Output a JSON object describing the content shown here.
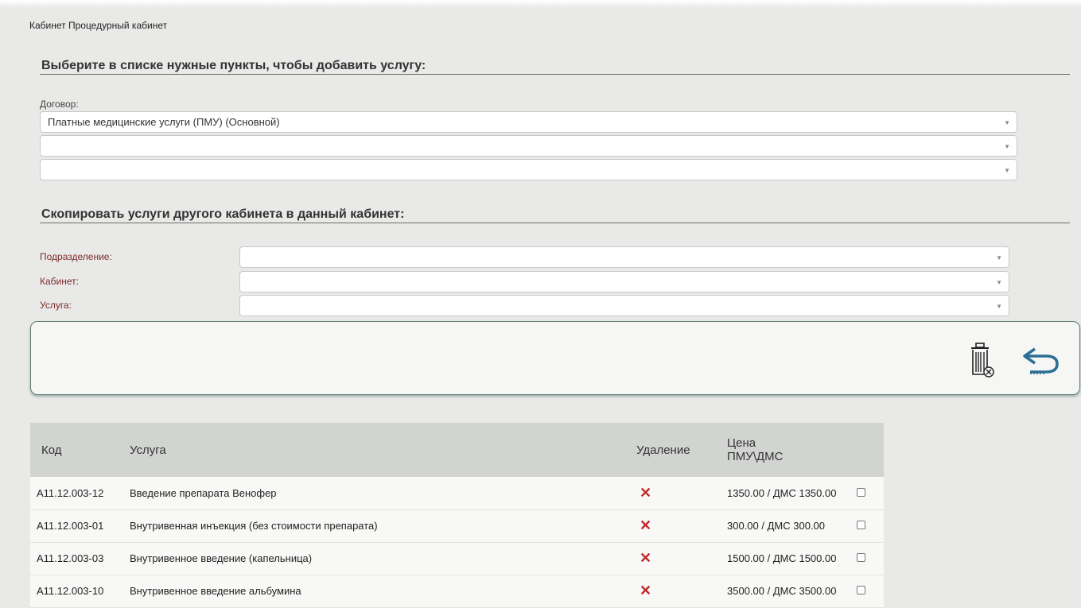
{
  "page": {
    "cabinet_title": "Кабинет Процедурный кабинет"
  },
  "add_section": {
    "heading": "Выберите в списке нужные пункты, чтобы добавить услугу:",
    "contract_label": "Договор:",
    "selects": [
      {
        "value": "Платные медицинские услуги (ПМУ) (Основной)"
      },
      {
        "value": ""
      },
      {
        "value": ""
      }
    ]
  },
  "copy_section": {
    "heading": "Скопировать услуги другого кабинета в данный кабинет:",
    "fields": [
      {
        "label": "Подразделение:",
        "value": ""
      },
      {
        "label": "Кабинет:",
        "value": ""
      },
      {
        "label": "Услуга:",
        "value": ""
      }
    ]
  },
  "actions": {
    "icons": [
      "trash-icon",
      "undo-arrow-icon"
    ]
  },
  "table": {
    "headers": {
      "code": "Код",
      "service": "Услуга",
      "delete": "Удаление",
      "price_line1": "Цена",
      "price_line2": "ПМУ\\ДМС"
    },
    "rows": [
      {
        "code": "A11.12.003-12",
        "service": "Введение препарата Венофер",
        "price": "1350.00 / ДМС 1350.00",
        "checked": false
      },
      {
        "code": "A11.12.003-01",
        "service": "Внутривенная инъекция (без стоимости препарата)",
        "price": "300.00 / ДМС 300.00",
        "checked": false
      },
      {
        "code": "A11.12.003-03",
        "service": "Внутривенное введение (капельница)",
        "price": "1500.00 / ДМС 1500.00",
        "checked": false
      },
      {
        "code": "A11.12.003-10",
        "service": "Внутривенное введение альбумина",
        "price": "3500.00 / ДМС 3500.00",
        "checked": false
      }
    ]
  },
  "colors": {
    "background": "#e9eae8",
    "delete_icon": "#c0292b",
    "accent_label": "#7a2a2a",
    "icon_blue": "#2c6f94",
    "panel_border": "#5f7f74"
  }
}
